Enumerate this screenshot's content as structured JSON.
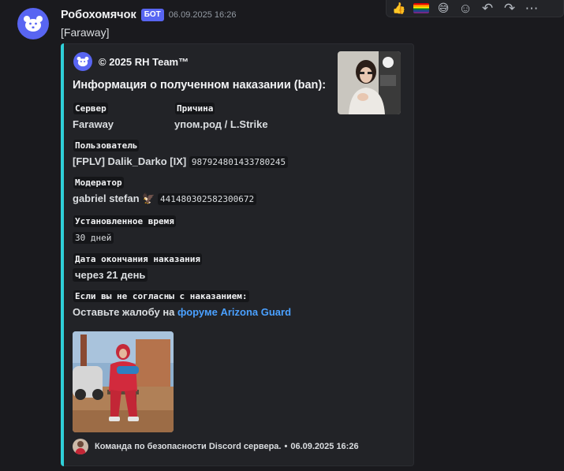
{
  "message": {
    "username": "Робохомячок",
    "bot_tag": "БОТ",
    "timestamp": "06.09.2025 16:26",
    "content": "[Faraway]"
  },
  "toolbar": {
    "icons": [
      "thumbs-up-icon",
      "rainbow-flag-icon",
      "grinning-sweat-icon",
      "add-reaction-icon",
      "reply-icon",
      "forward-icon",
      "more-icon"
    ],
    "glyphs": {
      "thumbs_up": "👍",
      "grin": "😅",
      "add_reaction": "☺",
      "reply": "↶",
      "forward": "↷",
      "more": "⋯"
    }
  },
  "embed": {
    "accent_color": "#2fd0d9",
    "author": "© 2025 RH Team™",
    "title": "Информация о полученном наказании (ban):",
    "fields": {
      "server_name": "Сервер",
      "server_value": "Faraway",
      "reason_name": "Причина",
      "reason_value": "упом.род / L.Strike",
      "user_name": "Пользователь",
      "user_value": "[FPLV] Dalik_Darko [IX]",
      "user_id": "987924801433780245",
      "moderator_name": "Модератор",
      "moderator_value": "gabriel stefan 🦅",
      "moderator_id": "441480302582300672",
      "duration_name": "Установленное время",
      "duration_value": "30 дней",
      "end_name": "Дата окончания наказания",
      "end_value": "через 21 день",
      "appeal_name": "Если вы не согласны с наказанием:",
      "appeal_text": "Оставьте жалобу на ",
      "appeal_link": "форуме Arizona Guard"
    },
    "footer": {
      "text": "Команда по безопасности Discord сервера.",
      "separator": "•",
      "timestamp": "06.09.2025 16:26"
    }
  }
}
